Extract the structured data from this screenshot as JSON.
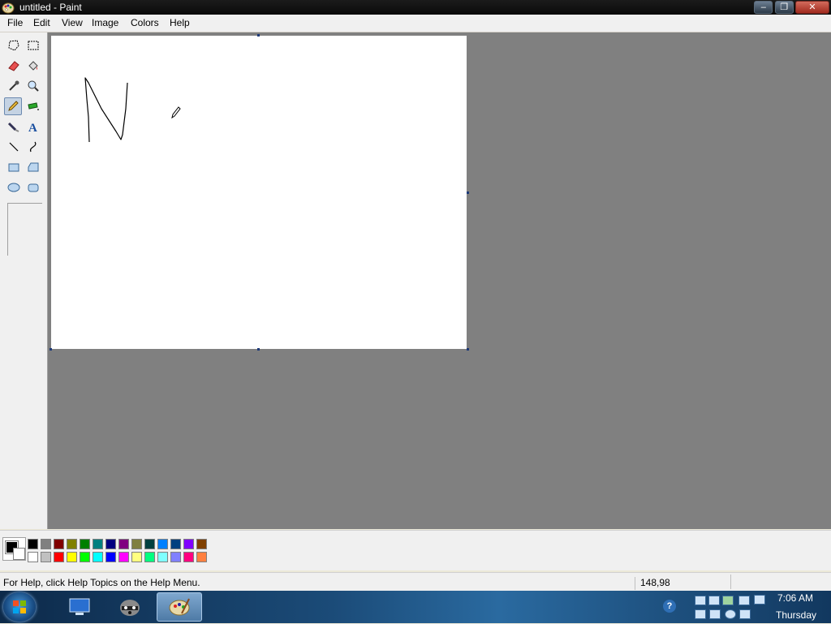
{
  "window": {
    "title": "untitled - Paint",
    "app_icon": "paint-palette-icon"
  },
  "window_buttons": {
    "minimize": "–",
    "restore": "❐",
    "close": "✕"
  },
  "menu": [
    {
      "label": "File"
    },
    {
      "label": "Edit"
    },
    {
      "label": "View"
    },
    {
      "label": "Image"
    },
    {
      "label": "Colors"
    },
    {
      "label": "Help"
    }
  ],
  "toolbox": {
    "selected_tool": "pencil",
    "tools": [
      "free-form-select-icon",
      "select-icon",
      "eraser-icon",
      "fill-bucket-icon",
      "color-picker-icon",
      "magnifier-icon",
      "pencil-icon",
      "airbrush-icon",
      "brush-icon",
      "text-icon",
      "line-icon",
      "curve-icon",
      "rectangle-icon",
      "polygon-icon",
      "ellipse-icon",
      "rounded-rectangle-icon"
    ]
  },
  "palette": {
    "foreground": "#000000",
    "background": "#ffffff",
    "row1": [
      "#000000",
      "#808080",
      "#800000",
      "#808000",
      "#008000",
      "#008080",
      "#000080",
      "#800080",
      "#808040",
      "#004040",
      "#0080ff",
      "#004080",
      "#8000ff",
      "#804000"
    ],
    "row2": [
      "#ffffff",
      "#c0c0c0",
      "#ff0000",
      "#ffff00",
      "#00ff00",
      "#00ffff",
      "#0000ff",
      "#ff00ff",
      "#ffff80",
      "#00ff80",
      "#80ffff",
      "#8080ff",
      "#ff0080",
      "#ff8040"
    ]
  },
  "status": {
    "help_text": "For Help, click Help Topics on the Help Menu.",
    "coordinates": "148,98"
  },
  "taskbar": {
    "buttons": [
      "computer-icon",
      "raccoon-app-icon",
      "paint-app-icon"
    ],
    "active": "paint-app-icon",
    "clock_time": "7:06 AM",
    "clock_day": "Thursday",
    "tray_help": "?"
  }
}
